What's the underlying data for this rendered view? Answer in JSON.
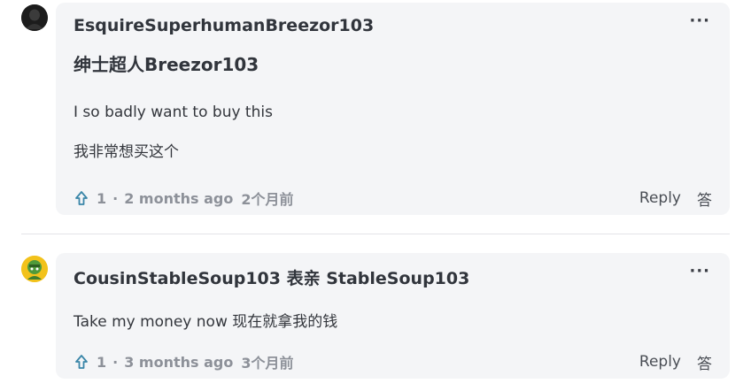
{
  "comments": [
    {
      "author": "EsquireSuperhumanBreezor103",
      "author_translation": "绅士超人Breezor103",
      "text": "I so badly want to buy this",
      "text_translation": "我非常想买这个",
      "upvotes": "1",
      "separator": "·",
      "time_ago": "2 months ago",
      "time_ago_translation": "2个月前",
      "reply_label": "Reply",
      "reply_translation": "答",
      "more_label": "···",
      "avatar_icon": "avatar-dark-icon",
      "avatar_color": "#1e1e1e"
    },
    {
      "author": "CousinStableSoup103   表亲 StableSoup103",
      "text": "Take my money now  现在就拿我的钱",
      "upvotes": "1",
      "separator": "·",
      "time_ago": "3 months ago",
      "time_ago_translation": "3个月前",
      "reply_label": "Reply",
      "reply_translation": "答",
      "more_label": "···",
      "avatar_icon": "avatar-green-character-icon",
      "avatar_color": "#f2c21b"
    }
  ],
  "colors": {
    "card_background": "#f4f5f7",
    "upvote_icon": "#3a86a8",
    "meta_text": "#8d9199"
  }
}
